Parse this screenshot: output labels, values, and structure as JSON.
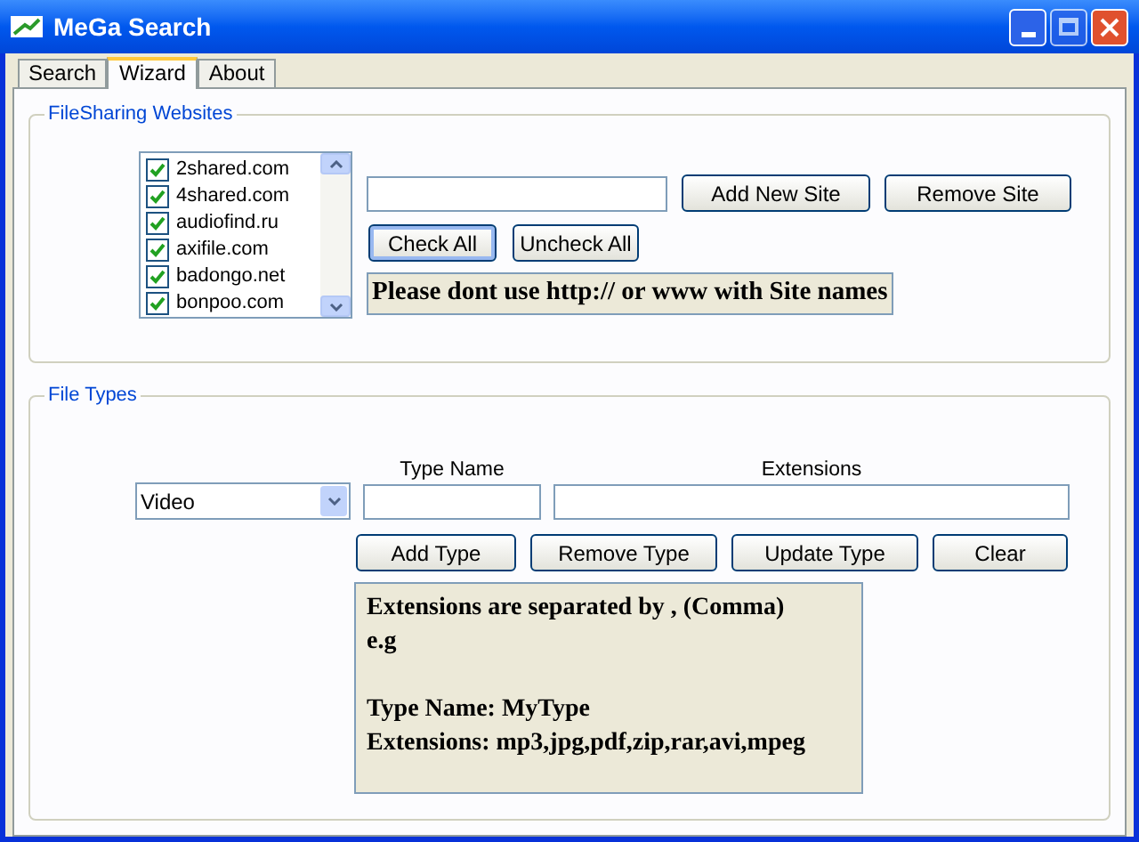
{
  "window": {
    "title": "MeGa Search"
  },
  "tabs": [
    {
      "label": "Search",
      "selected": false
    },
    {
      "label": "Wizard",
      "selected": true
    },
    {
      "label": "About",
      "selected": false
    }
  ],
  "sites_group": {
    "title": "FileSharing Websites",
    "sites": [
      {
        "name": "2shared.com",
        "checked": true
      },
      {
        "name": "4shared.com",
        "checked": true
      },
      {
        "name": "audiofind.ru",
        "checked": true
      },
      {
        "name": "axifile.com",
        "checked": true
      },
      {
        "name": "badongo.net",
        "checked": true
      },
      {
        "name": "bonpoo.com",
        "checked": true
      }
    ],
    "buttons": [
      "Add New Site",
      "Remove Site"
    ],
    "check_buttons": [
      {
        "label": "Check All",
        "selected": true
      },
      {
        "label": "Uncheck All",
        "selected": false
      }
    ],
    "note": "Please dont use http:// or www with Site names"
  },
  "types_group": {
    "title": "File Types",
    "type_select": "Video",
    "type_name_label": "Type Name",
    "extensions_label": "Extensions",
    "buttons": [
      "Add Type",
      "Remove Type",
      "Update Type",
      "Clear"
    ],
    "info_paragraphs": [
      [
        "Extensions are separated by , (Comma)",
        "e.g"
      ],
      [
        "Type Name: MyType",
        "Extensions: mp3,jpg,pdf,zip,rar,avi,mpeg"
      ]
    ]
  }
}
